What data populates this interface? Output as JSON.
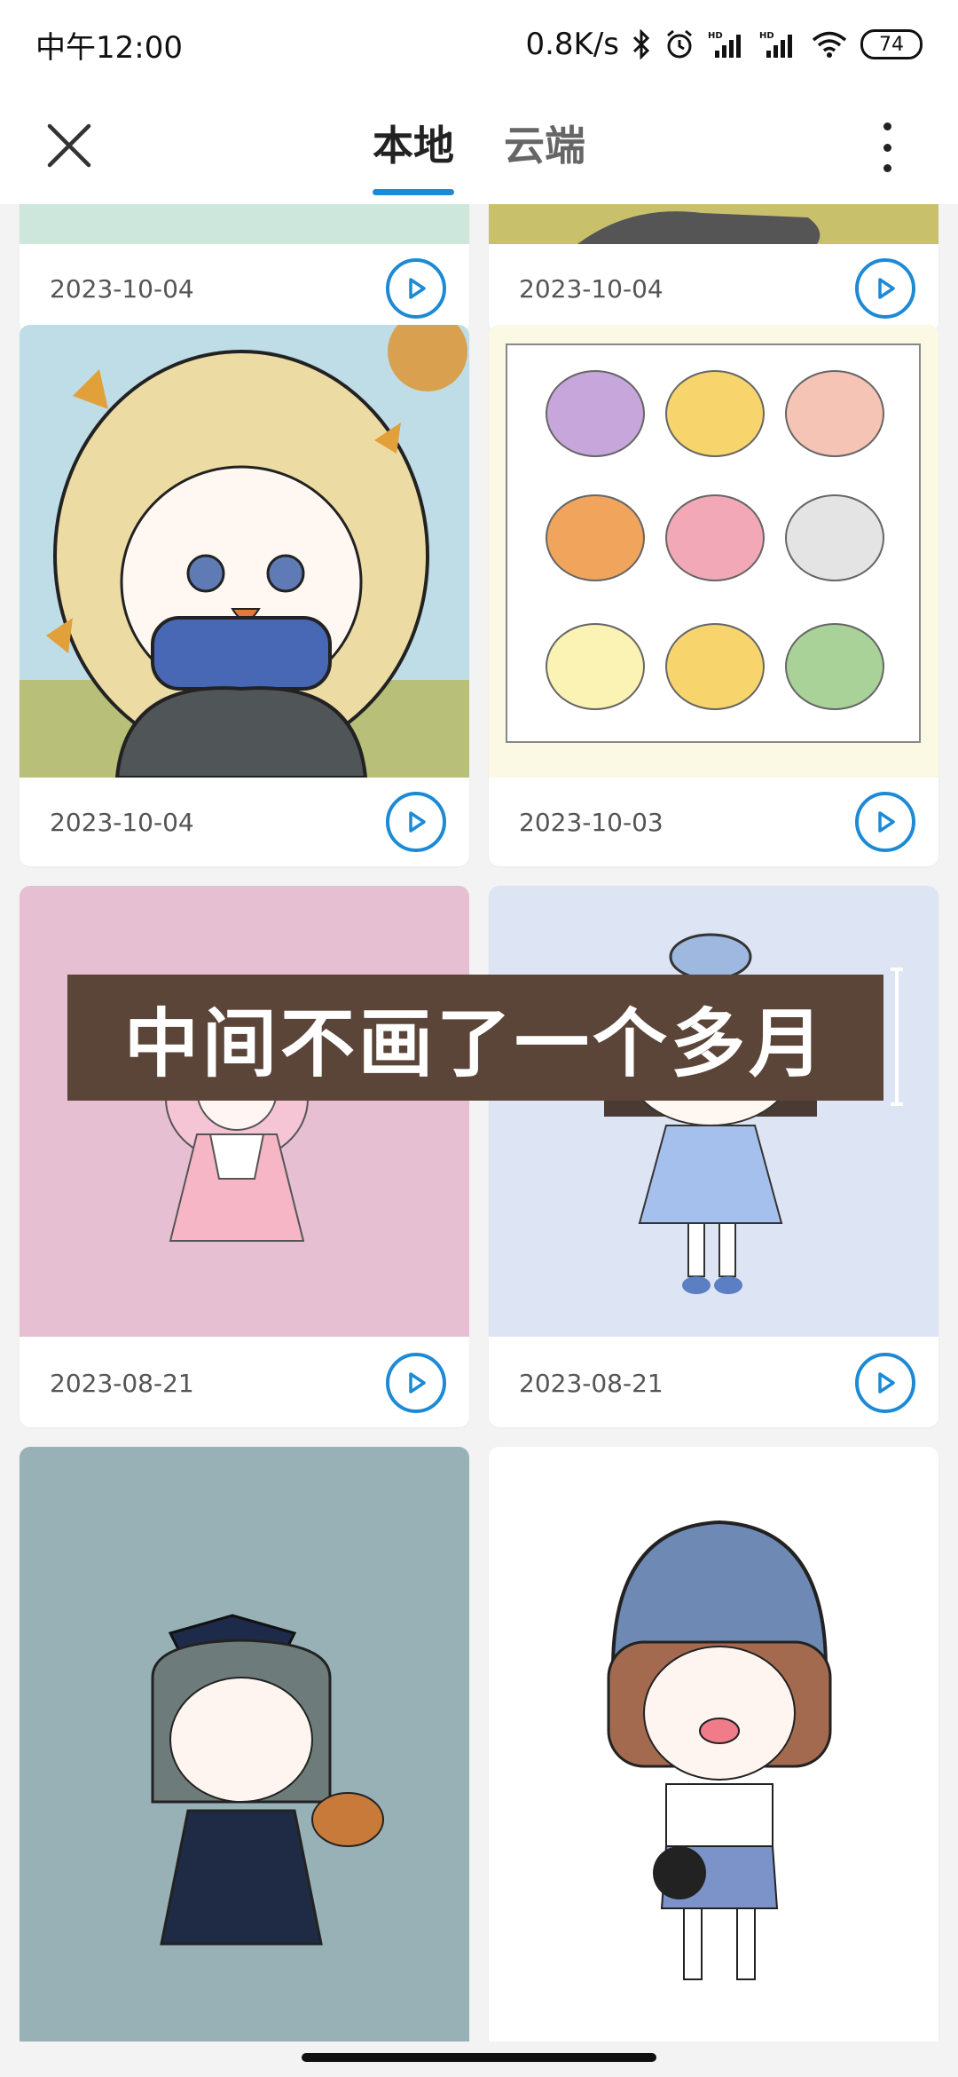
{
  "status_bar": {
    "time": "中午12:00",
    "network_speed": "0.8K/s",
    "battery": "74",
    "icons": [
      "bluetooth-icon",
      "alarm-icon",
      "signal-hd-icon",
      "signal-hd-icon",
      "wifi-icon",
      "battery-icon"
    ]
  },
  "appbar": {
    "tabs": [
      {
        "label": "本地",
        "active": true
      },
      {
        "label": "云端",
        "active": false
      }
    ],
    "accent": "#1d8ad6"
  },
  "gallery": {
    "items": [
      {
        "date": "2023-10-04",
        "thumb": "partial-top-left",
        "bg": "#cde7dc"
      },
      {
        "date": "2023-10-04",
        "thumb": "partial-top-right",
        "bg": "#c9c06c"
      },
      {
        "date": "2023-10-04",
        "thumb": "girl-scarf-autumn",
        "bg": "#bfdde6"
      },
      {
        "date": "2023-10-03",
        "thumb": "mooncakes-grid",
        "bg": "#fbf8e4"
      },
      {
        "date": "2023-08-21",
        "thumb": "girl-pink-dress",
        "bg": "#e6bfd3"
      },
      {
        "date": "2023-08-21",
        "thumb": "girl-blue-dress",
        "bg": "#dde5f4"
      },
      {
        "date": "",
        "thumb": "girl-bow-hamster",
        "bg": "#97b1b7"
      },
      {
        "date": "",
        "thumb": "girl-blue-helmet",
        "bg": "#ffffff"
      }
    ]
  },
  "overlay": {
    "caption": "中间不画了一个多月"
  }
}
